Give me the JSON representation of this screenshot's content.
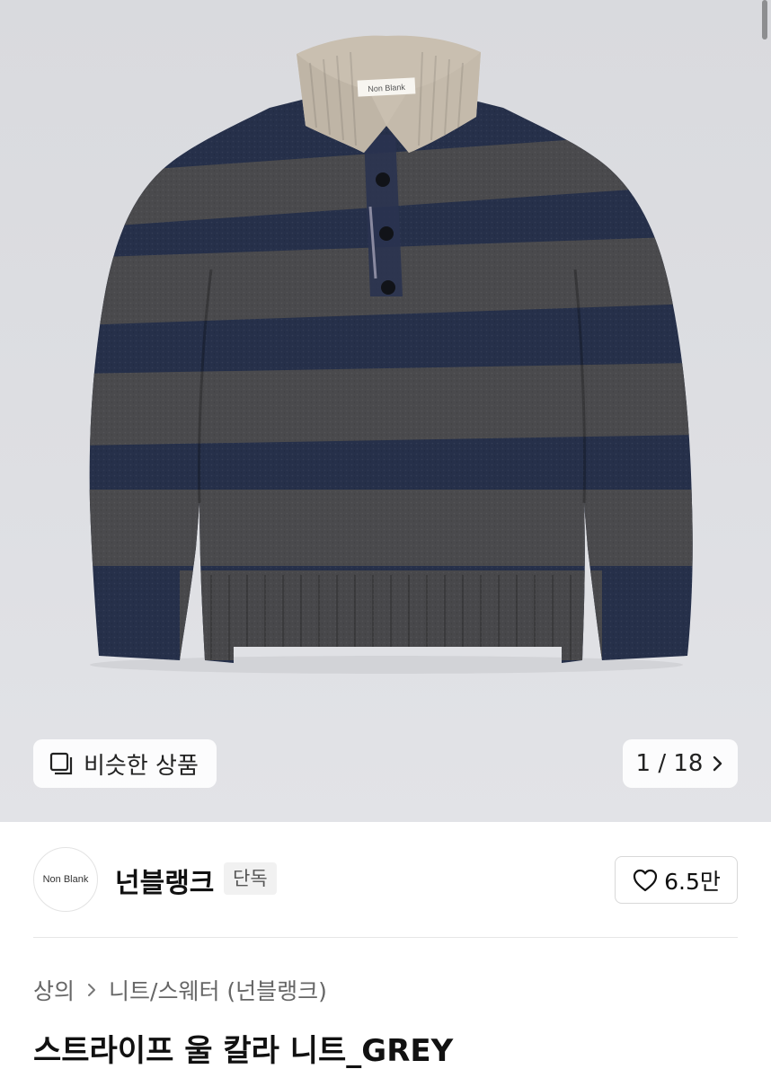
{
  "gallery": {
    "tag_label": "Non Blank",
    "similar_button_label": "비슷한 상품",
    "counter": "1 / 18"
  },
  "brand": {
    "logo_text": "Non Blank",
    "name": "넌블랭크",
    "tag": "단독",
    "likes": "6.5만"
  },
  "breadcrumb": {
    "category": "상의",
    "subcategory": "니트/스웨터 (넌블랭크)"
  },
  "product": {
    "title": "스트라이프 울 칼라 니트_GREY"
  },
  "colors": {
    "navy_stripe": "#26304a",
    "grey_stripe": "#4a4a4d",
    "collar": "#c9bfb0",
    "background": "#dedfe3"
  }
}
